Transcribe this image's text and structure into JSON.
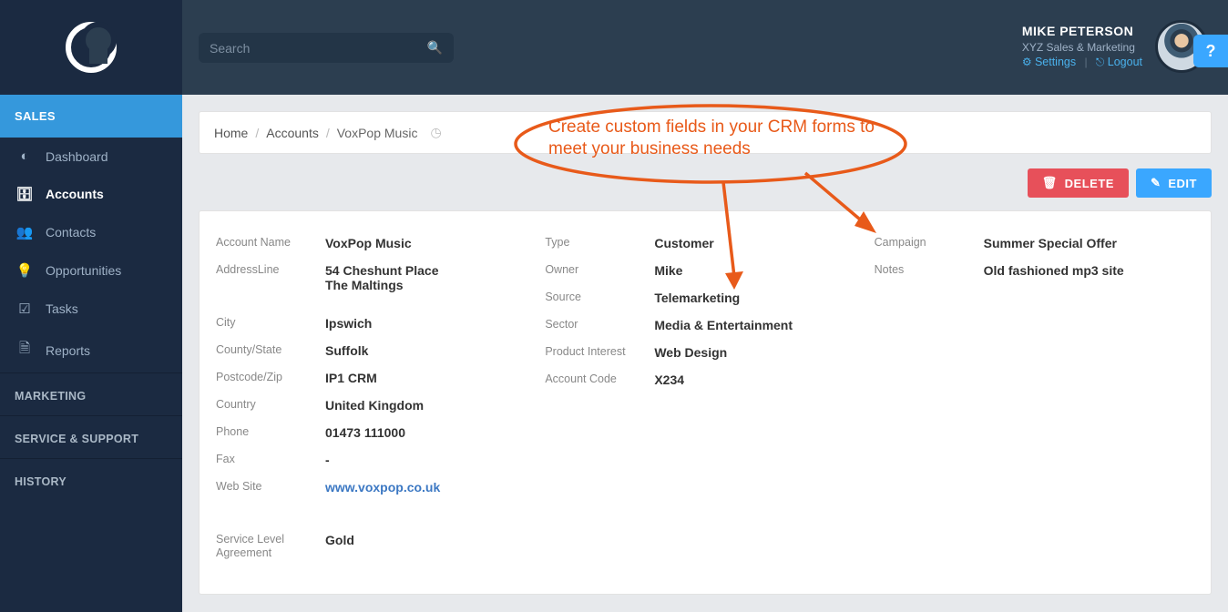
{
  "topbar": {
    "search_placeholder": "Search",
    "user_name": "MIKE PETERSON",
    "user_org": "XYZ Sales & Marketing",
    "settings_label": "Settings",
    "logout_label": "Logout",
    "help_label": "?"
  },
  "sidebar": {
    "sections": {
      "sales": "SALES",
      "marketing": "MARKETING",
      "service_support": "SERVICE & SUPPORT",
      "history": "HISTORY"
    },
    "items": [
      {
        "icon": "dashboard-icon",
        "label": "Dashboard",
        "glyph": "◐"
      },
      {
        "icon": "accounts-icon",
        "label": "Accounts",
        "glyph": "🗄"
      },
      {
        "icon": "contacts-icon",
        "label": "Contacts",
        "glyph": "👥"
      },
      {
        "icon": "opportunities-icon",
        "label": "Opportunities",
        "glyph": "💡"
      },
      {
        "icon": "tasks-icon",
        "label": "Tasks",
        "glyph": "☑"
      },
      {
        "icon": "reports-icon",
        "label": "Reports",
        "glyph": "🗎"
      }
    ]
  },
  "breadcrumbs": {
    "home": "Home",
    "accounts": "Accounts",
    "current": "VoxPop Music"
  },
  "actions": {
    "delete_label": "DELETE",
    "edit_label": "EDIT"
  },
  "details": {
    "col1": {
      "account_name_label": "Account Name",
      "account_name_value": "VoxPop Music",
      "address_label": "AddressLine",
      "address_value_line1": "54 Cheshunt Place",
      "address_value_line2": "The Maltings",
      "city_label": "City",
      "city_value": "Ipswich",
      "county_label": "County/State",
      "county_value": "Suffolk",
      "postcode_label": "Postcode/Zip",
      "postcode_value": "IP1 CRM",
      "country_label": "Country",
      "country_value": "United Kingdom",
      "phone_label": "Phone",
      "phone_value": "01473 111000",
      "fax_label": "Fax",
      "fax_value": "-",
      "website_label": "Web Site",
      "website_value": "www.voxpop.co.uk",
      "sla_label": "Service Level Agreement",
      "sla_value": "Gold"
    },
    "col2": {
      "type_label": "Type",
      "type_value": "Customer",
      "owner_label": "Owner",
      "owner_value": "Mike",
      "source_label": "Source",
      "source_value": "Telemarketing",
      "sector_label": "Sector",
      "sector_value": "Media & Entertainment",
      "product_interest_label": "Product Interest",
      "product_interest_value": "Web Design",
      "account_code_label": "Account Code",
      "account_code_value": "X234"
    },
    "col3": {
      "campaign_label": "Campaign",
      "campaign_value": "Summer Special Offer",
      "notes_label": "Notes",
      "notes_value": "Old fashioned mp3 site"
    }
  },
  "annotation": {
    "text": "Create custom fields in your CRM forms to meet your business needs"
  }
}
